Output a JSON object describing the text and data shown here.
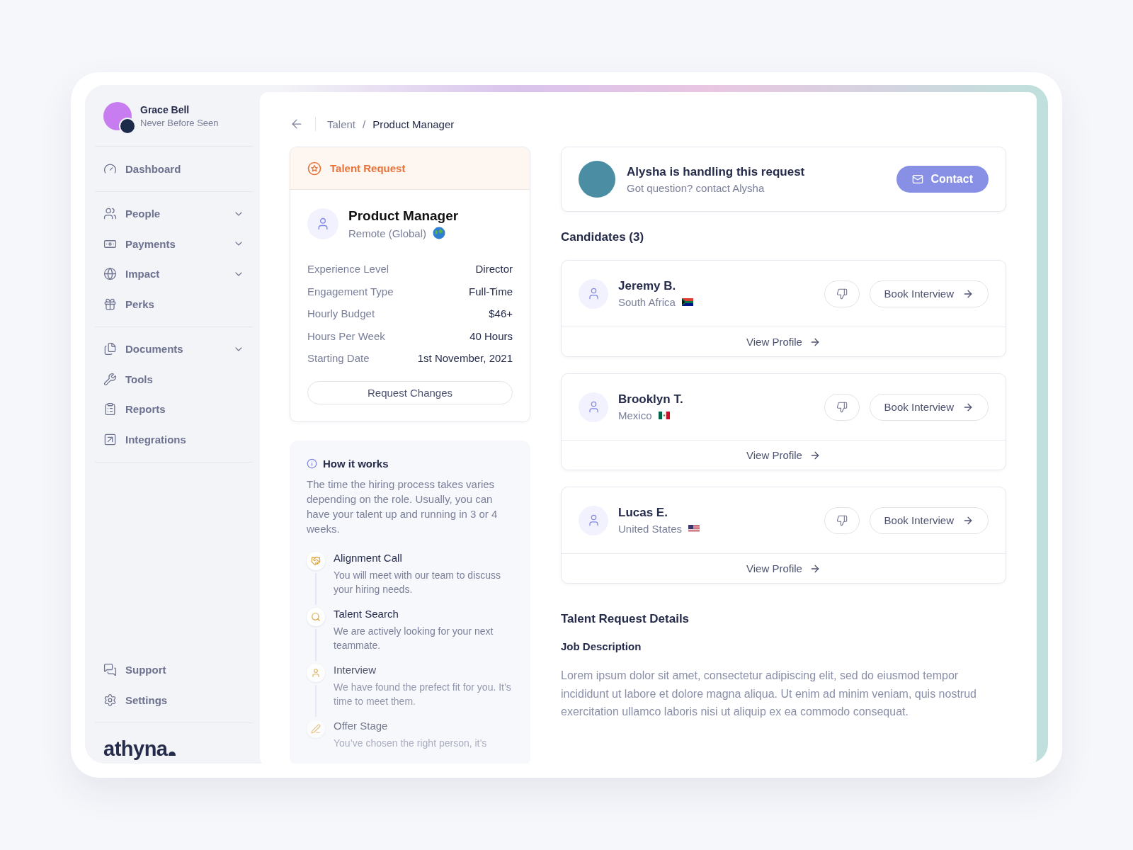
{
  "user": {
    "name": "Grace Bell",
    "subtitle": "Never Before Seen"
  },
  "nav_groups": [
    [
      {
        "label": "Dashboard",
        "has_submenu": false
      }
    ],
    [
      {
        "label": "People",
        "has_submenu": true
      },
      {
        "label": "Payments",
        "has_submenu": true
      },
      {
        "label": "Impact",
        "has_submenu": true
      },
      {
        "label": "Perks",
        "has_submenu": false
      }
    ],
    [
      {
        "label": "Documents",
        "has_submenu": true
      },
      {
        "label": "Tools",
        "has_submenu": false
      },
      {
        "label": "Reports",
        "has_submenu": false
      },
      {
        "label": "Integrations",
        "has_submenu": false
      }
    ]
  ],
  "bottom_nav": [
    {
      "label": "Support"
    },
    {
      "label": "Settings"
    }
  ],
  "logo": "athyna",
  "breadcrumb": [
    "Talent",
    "Product Manager"
  ],
  "breadcrumb_separator": "/",
  "talent_request": {
    "header": "Talent Request",
    "title": "Product Manager",
    "location": "Remote (Global)",
    "details": [
      {
        "label": "Experience Level",
        "value": "Director"
      },
      {
        "label": "Engagement Type",
        "value": "Full-Time"
      },
      {
        "label": "Hourly Budget",
        "value": "$46+"
      },
      {
        "label": "Hours Per Week",
        "value": "40 Hours"
      },
      {
        "label": "Starting Date",
        "value": "1st November, 2021"
      }
    ],
    "button": "Request Changes"
  },
  "how_it_works": {
    "title": "How it works",
    "text": "The time the hiring process takes varies depending on the role. Usually, you can have your talent up and running in 3 or 4 weeks.",
    "steps": [
      {
        "title": "Alignment Call",
        "text": "You will meet with our team to discuss your hiring needs."
      },
      {
        "title": "Talent Search",
        "text": "We are actively looking for your next teammate."
      },
      {
        "title": "Interview",
        "text": "We have found the prefect fit for you. It’s time to meet them."
      },
      {
        "title": "Offer Stage",
        "text": "You’ve chosen the right person, it’s"
      }
    ]
  },
  "handler": {
    "title": "Alysha is handling this request",
    "subtitle": "Got question? contact Alysha",
    "button": "Contact"
  },
  "candidates_heading": "Candidates (3)",
  "candidates": [
    {
      "name": "Jeremy B.",
      "country": "South Africa",
      "book_label": "Book Interview",
      "profile_label": "View Profile"
    },
    {
      "name": "Brooklyn T.",
      "country": "Mexico",
      "book_label": "Book Interview",
      "profile_label": "View Profile"
    },
    {
      "name": "Lucas E.",
      "country": "United States",
      "book_label": "Book Interview",
      "profile_label": "View Profile"
    }
  ],
  "details": {
    "heading": "Talent Request Details",
    "subheading": "Job Description",
    "text": "Lorem ipsum dolor sit amet, consectetur adipiscing elit, sed do eiusmod tempor incididunt ut labore et dolore magna aliqua. Ut enim ad minim veniam, quis nostrud exercitation ullamco laboris nisi ut aliquip ex ea commodo consequat."
  }
}
